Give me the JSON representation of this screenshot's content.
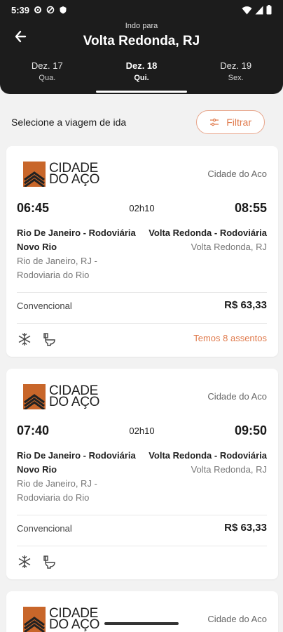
{
  "status_bar": {
    "time": "5:39"
  },
  "header": {
    "subtitle": "Indo para",
    "title": "Volta Redonda, RJ",
    "dates": [
      {
        "date": "Dez. 17",
        "weekday": "Qua."
      },
      {
        "date": "Dez. 18",
        "weekday": "Qui."
      },
      {
        "date": "Dez. 19",
        "weekday": "Sex."
      }
    ]
  },
  "selection": {
    "label": "Selecione a viagem de ida",
    "filter_label": "Filtrar"
  },
  "trips": [
    {
      "logo_line1": "CIDADE",
      "logo_line2": "DO AÇO",
      "company": "Cidade do Aco",
      "departure": "06:45",
      "duration": "02h10",
      "arrival": "08:55",
      "origin_name": "Rio De Janeiro - Rodoviária Novo Rio",
      "origin_city": "Rio de Janeiro, RJ - Rodoviaria do Rio",
      "dest_name": "Volta Redonda - Rodoviária",
      "dest_city": "Volta Redonda, RJ",
      "class": "Convencional",
      "price": "R$ 63,33",
      "seats": "Temos 8 assentos"
    },
    {
      "logo_line1": "CIDADE",
      "logo_line2": "DO AÇO",
      "company": "Cidade do Aco",
      "departure": "07:40",
      "duration": "02h10",
      "arrival": "09:50",
      "origin_name": "Rio De Janeiro - Rodoviária Novo Rio",
      "origin_city": "Rio de Janeiro, RJ - Rodoviaria do Rio",
      "dest_name": "Volta Redonda - Rodoviária",
      "dest_city": "Volta Redonda, RJ",
      "class": "Convencional",
      "price": "R$ 63,33"
    },
    {
      "logo_line1": "CIDADE",
      "logo_line2": "DO AÇO",
      "company": "Cidade do Aco"
    }
  ],
  "colors": {
    "accent": "#e07a4c",
    "header_bg": "#1c1c1c",
    "logo_orange": "#c8662a"
  }
}
